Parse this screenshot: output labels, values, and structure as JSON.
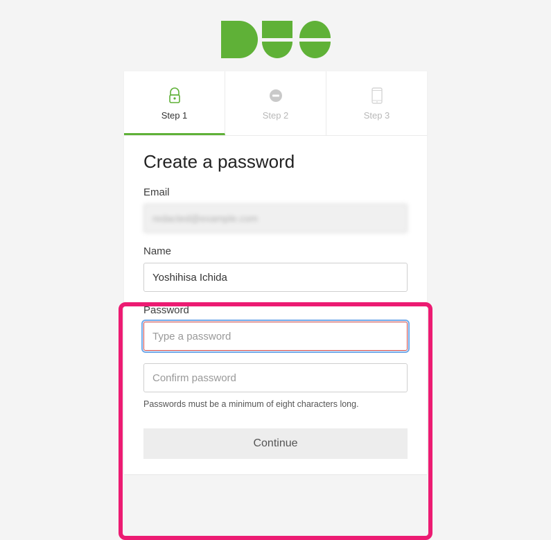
{
  "brand": {
    "name": "DUO",
    "color": "#5fb137"
  },
  "tabs": [
    {
      "label": "Step 1",
      "icon": "padlock-icon",
      "active": true
    },
    {
      "label": "Step 2",
      "icon": "badge-icon",
      "active": false
    },
    {
      "label": "Step 3",
      "icon": "phone-icon",
      "active": false
    }
  ],
  "form": {
    "heading": "Create a password",
    "email": {
      "label": "Email",
      "value": "redacted@example.com"
    },
    "name": {
      "label": "Name",
      "value": "Yoshihisa Ichida"
    },
    "password": {
      "label": "Password",
      "placeholder": "Type a password"
    },
    "confirm": {
      "placeholder": "Confirm password"
    },
    "hint": "Passwords must be a minimum of eight characters long.",
    "continue_label": "Continue"
  }
}
